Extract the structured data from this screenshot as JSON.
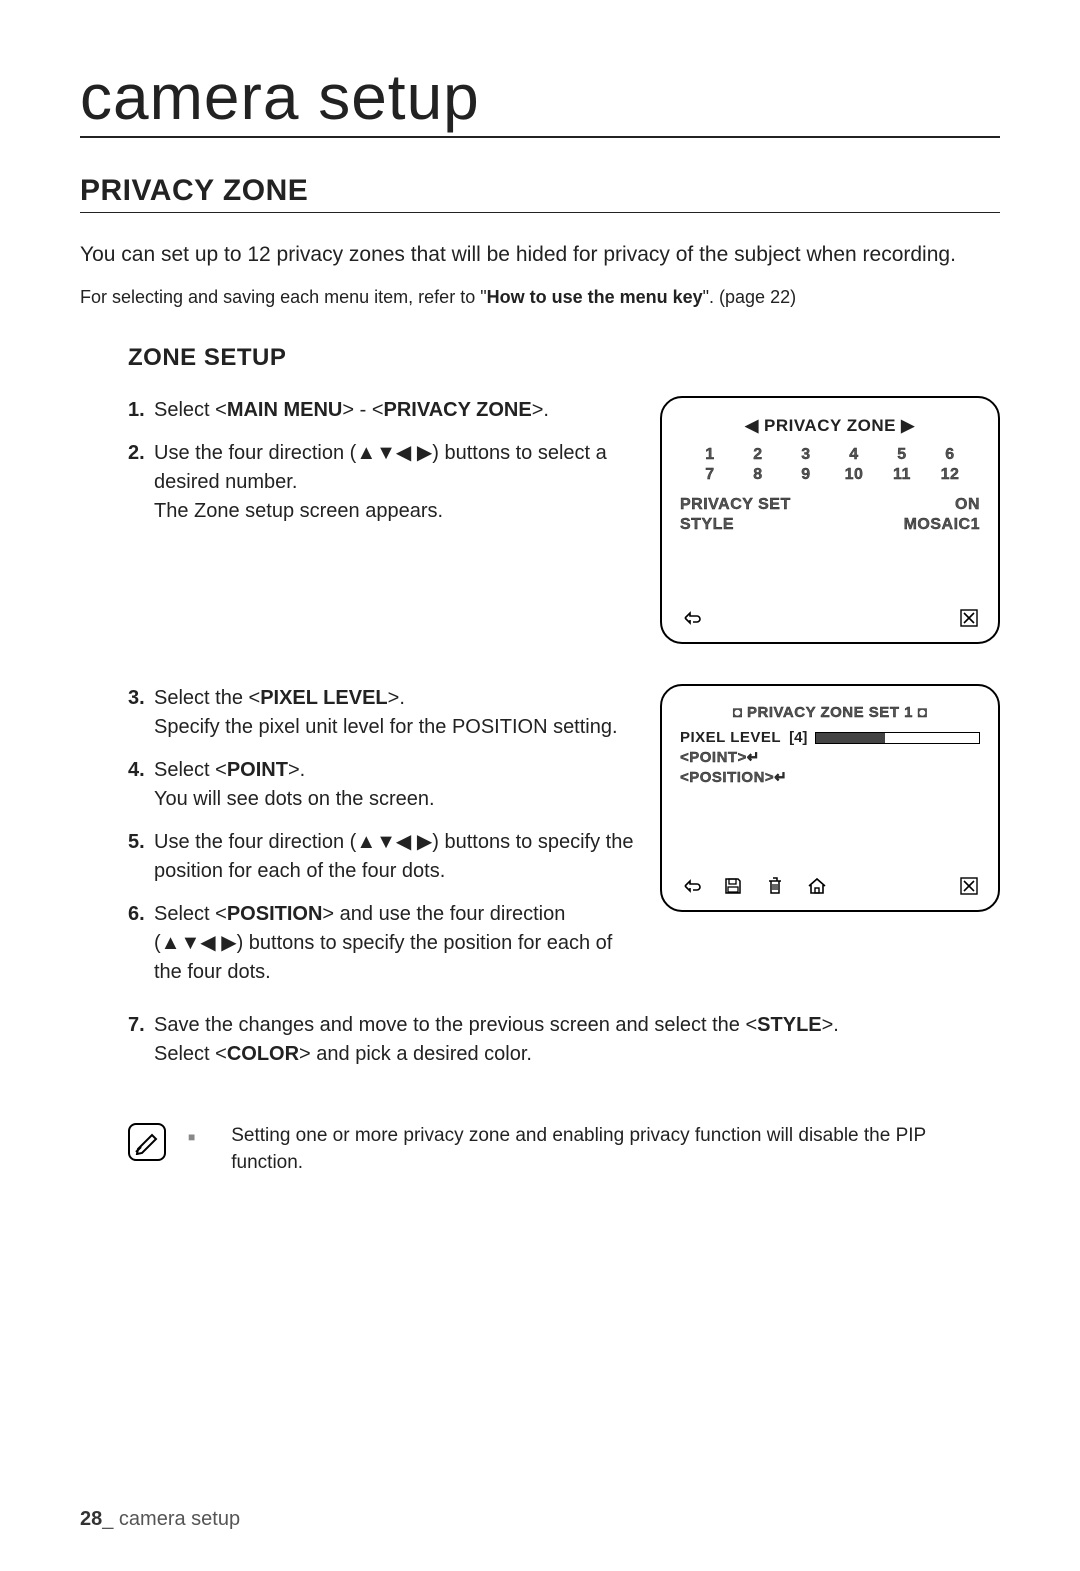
{
  "page": {
    "title": "camera setup",
    "section": "PRIVACY ZONE",
    "intro": "You can set up to 12 privacy zones that will be hided for privacy of the subject when recording.",
    "refnote_pre": "For selecting and saving each menu item, refer to \"",
    "refnote_bold": "How to use the menu key",
    "refnote_post": "\". (page 22)",
    "subsection": "ZONE SETUP",
    "number": "28",
    "footer_label": "_ camera setup"
  },
  "steps": {
    "s1_pre": "Select <",
    "s1_b1": "MAIN MENU",
    "s1_mid": "> - <",
    "s1_b2": "PRIVACY ZONE",
    "s1_post": ">.",
    "s2_a": "Use the four direction (",
    "s2_b": ") buttons to select a desired number.",
    "s2_c": "The Zone setup screen appears.",
    "s3_a": "Select the <",
    "s3_b": "PIXEL LEVEL",
    "s3_c": ">.",
    "s3_d": "Specify the pixel unit level for the POSITION setting.",
    "s4_a": "Select <",
    "s4_b": "POINT",
    "s4_c": ">.",
    "s4_d": "You will see dots on the screen.",
    "s5_a": "Use the four direction (",
    "s5_b": ") buttons to specify the position for each of the four dots.",
    "s6_a": "Select <",
    "s6_b": "POSITION",
    "s6_c": "> and use the four direction (",
    "s6_d": ") buttons to specify the position for each of the four dots.",
    "s7_a": "Save the changes and move to the previous screen and select the <",
    "s7_b": "STYLE",
    "s7_c": ">.",
    "s7_d": "Select <",
    "s7_e": "COLOR",
    "s7_f": "> and pick a desired color."
  },
  "osd1": {
    "title": "◀ PRIVACY ZONE ▶",
    "nums": [
      "1",
      "2",
      "3",
      "4",
      "5",
      "6",
      "7",
      "8",
      "9",
      "10",
      "11",
      "12"
    ],
    "row1_l": "PRIVACY SET",
    "row1_r": "ON",
    "row2_l": "STYLE",
    "row2_r": "MOSAIC1"
  },
  "osd2": {
    "title": "◘ PRIVACY ZONE SET 1 ◘",
    "pl_label": "PIXEL LEVEL",
    "pl_val": "[4]",
    "point": "<POINT>↵",
    "position": "<POSITION>↵"
  },
  "note": {
    "text": "Setting one or more privacy zone and enabling privacy function will disable the PIP function."
  },
  "arrows": "▲▼◀ ▶"
}
